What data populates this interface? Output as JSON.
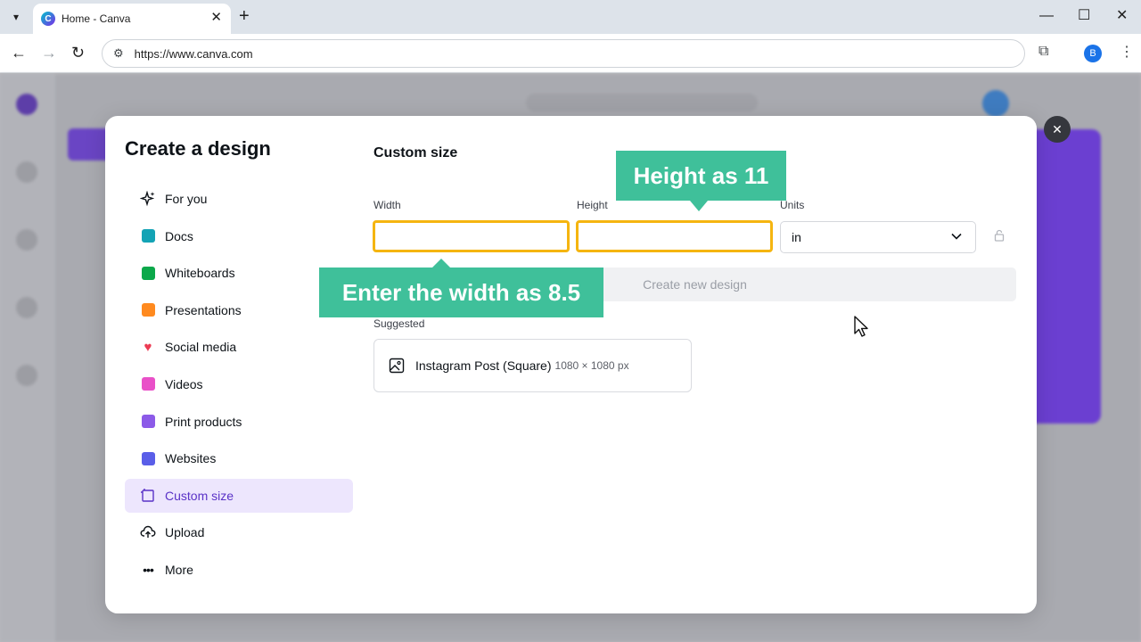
{
  "browser": {
    "tab_title": "Home - Canva",
    "favicon_letter": "C",
    "url": "https://www.canva.com",
    "profile_initial": "B"
  },
  "modal": {
    "title": "Create a design",
    "menu": [
      {
        "label": "For you",
        "icon": "sparkle-icon"
      },
      {
        "label": "Docs",
        "icon": "docs-icon"
      },
      {
        "label": "Whiteboards",
        "icon": "whiteboard-icon"
      },
      {
        "label": "Presentations",
        "icon": "presentation-icon"
      },
      {
        "label": "Social media",
        "icon": "heart-icon"
      },
      {
        "label": "Videos",
        "icon": "video-icon"
      },
      {
        "label": "Print products",
        "icon": "print-icon"
      },
      {
        "label": "Websites",
        "icon": "website-icon"
      },
      {
        "label": "Custom size",
        "icon": "custom-size-icon",
        "active": true
      },
      {
        "label": "Upload",
        "icon": "upload-icon"
      },
      {
        "label": "More",
        "icon": "more-icon"
      }
    ],
    "custom_size": {
      "title": "Custom size",
      "width_label": "Width",
      "width_value": "",
      "height_label": "Height",
      "height_value": "",
      "units_label": "Units",
      "units_value": "in",
      "create_button": "Create new design",
      "suggested_label": "Suggested",
      "suggestion_name": "Instagram Post (Square)",
      "suggestion_dims": "1080 × 1080 px"
    }
  },
  "callouts": {
    "height": "Height as 11",
    "width": "Enter the width as 8.5"
  },
  "colors": {
    "accent_purple": "#5a32c7",
    "field_highlight": "#f5b510",
    "callout_green": "#3fc09a"
  }
}
